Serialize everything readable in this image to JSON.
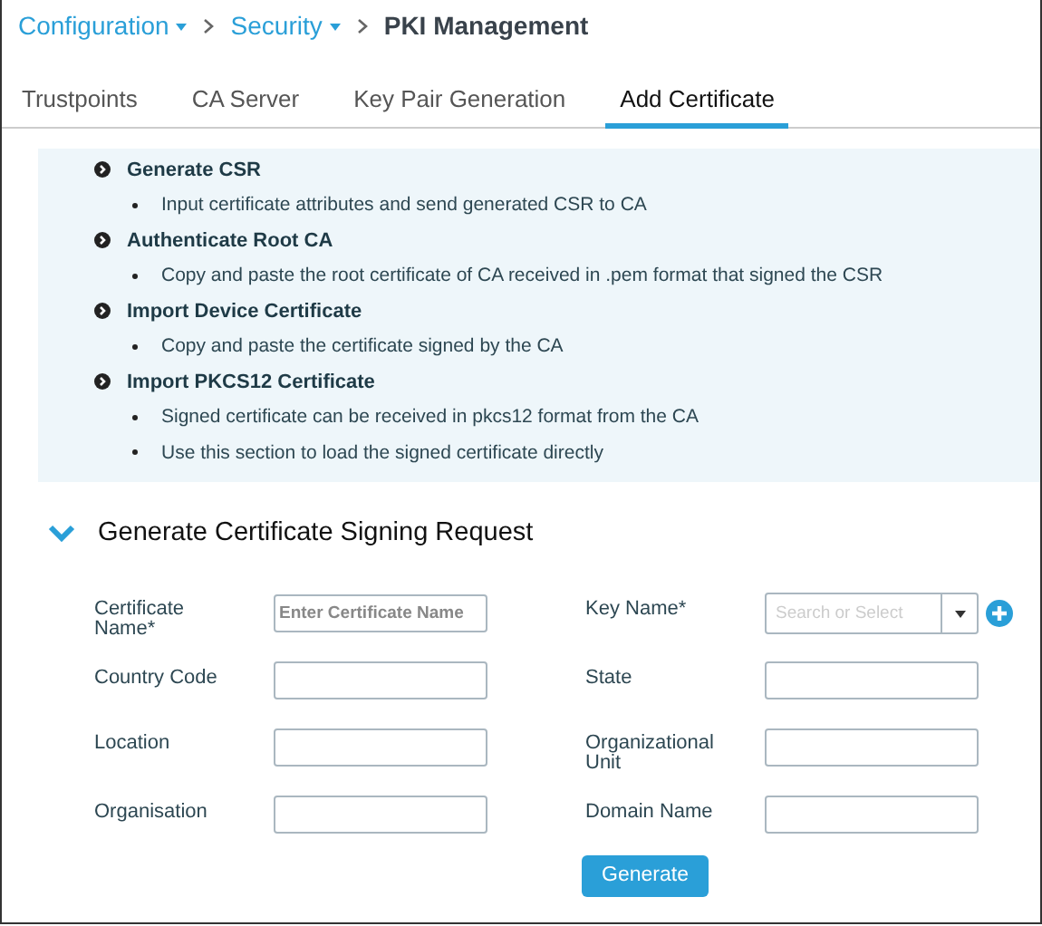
{
  "breadcrumb": [
    {
      "label": "Configuration",
      "kind": "menu"
    },
    {
      "label": "Security",
      "kind": "menu"
    },
    {
      "label": "PKI Management",
      "kind": "current"
    }
  ],
  "tabs": [
    {
      "label": "Trustpoints",
      "selected": false
    },
    {
      "label": "CA Server",
      "selected": false
    },
    {
      "label": "Key Pair Generation",
      "selected": false
    },
    {
      "label": "Add Certificate",
      "selected": true
    }
  ],
  "info": [
    {
      "title": "Generate CSR",
      "points": [
        "Input certificate attributes and send generated CSR to CA"
      ]
    },
    {
      "title": "Authenticate Root CA",
      "points": [
        "Copy and paste the root certificate of CA received in .pem format that signed the CSR"
      ]
    },
    {
      "title": "Import Device Certificate",
      "points": [
        "Copy and paste the certificate signed by the CA"
      ]
    },
    {
      "title": "Import PKCS12 Certificate",
      "points": [
        "Signed certificate can be received in pkcs12 format from the CA",
        "Use this section to load the signed certificate directly"
      ]
    }
  ],
  "section": {
    "title": "Generate Certificate Signing Request",
    "expanded": true
  },
  "fields": [
    {
      "label": "Certificate Name*",
      "kind": "text",
      "placeholder": "Enter Certificate Name"
    },
    {
      "label": "Key Name*",
      "kind": "combo",
      "placeholder": "Search or Select"
    },
    {
      "label": "Country Code",
      "kind": "text"
    },
    {
      "label": "State",
      "kind": "text"
    },
    {
      "label": "Location",
      "kind": "text"
    },
    {
      "label": "Organizational Unit",
      "kind": "text"
    },
    {
      "label": "Organisation",
      "kind": "text"
    },
    {
      "label": "Domain Name",
      "kind": "text"
    }
  ],
  "button": "Generate"
}
